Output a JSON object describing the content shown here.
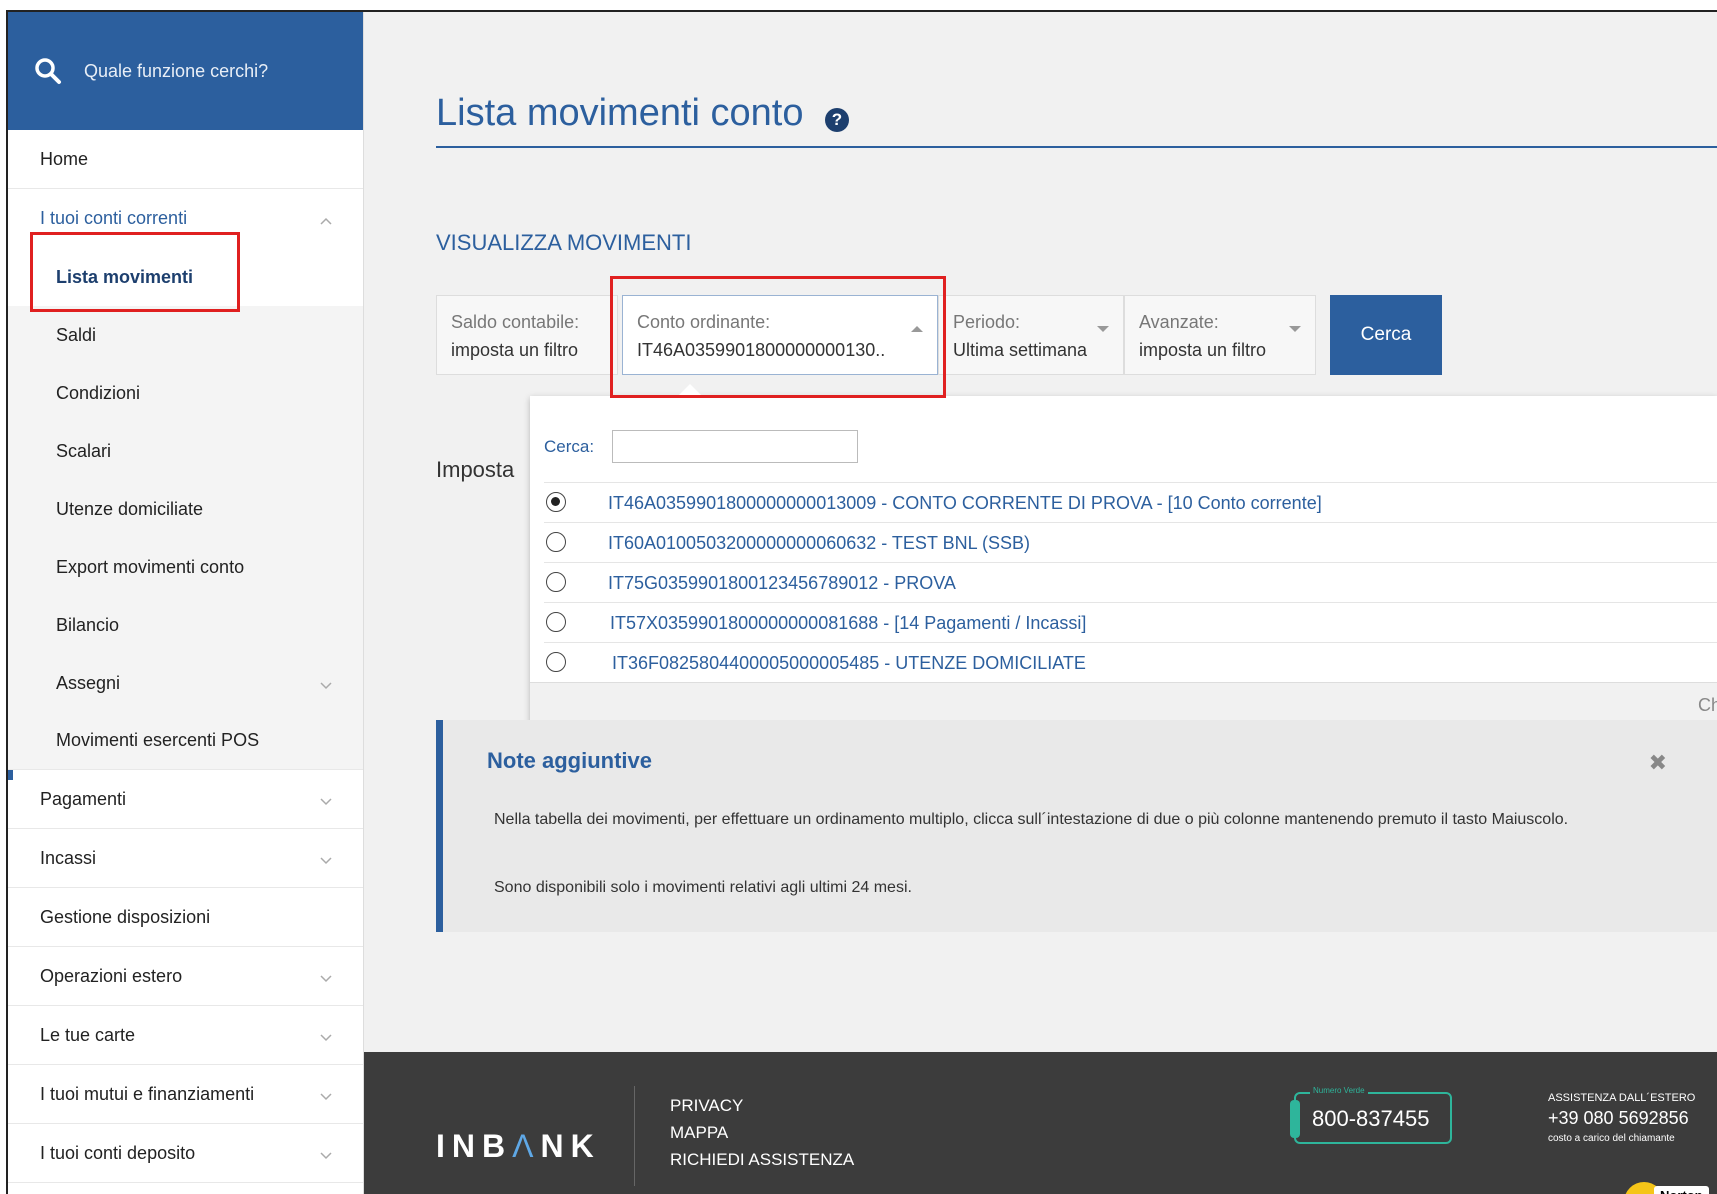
{
  "search": {
    "placeholder": "Quale funzione cerchi?"
  },
  "sidebar": {
    "home": "Home",
    "group": {
      "label": "I tuoi conti correnti"
    },
    "sub_items": [
      {
        "label": "Lista movimenti"
      },
      {
        "label": "Saldi"
      },
      {
        "label": "Condizioni"
      },
      {
        "label": "Scalari"
      },
      {
        "label": "Utenze domiciliate"
      },
      {
        "label": "Export movimenti conto"
      },
      {
        "label": "Bilancio"
      },
      {
        "label": "Assegni"
      },
      {
        "label": "Movimenti esercenti POS"
      }
    ],
    "items": [
      {
        "label": "Pagamenti"
      },
      {
        "label": "Incassi"
      },
      {
        "label": "Gestione disposizioni"
      },
      {
        "label": "Operazioni estero"
      },
      {
        "label": "Le tue carte"
      },
      {
        "label": "I tuoi mutui e finanziamenti"
      },
      {
        "label": "I tuoi conti deposito"
      }
    ]
  },
  "page": {
    "title": "Lista movimenti conto",
    "help_icon": "?",
    "section": "VISUALIZZA MOVIMENTI",
    "imposta": "Imposta"
  },
  "filters": {
    "saldo": {
      "label": "Saldo contabile:",
      "value": "imposta un filtro"
    },
    "conto": {
      "label": "Conto ordinante:",
      "value": "IT46A0359901800000000130.."
    },
    "periodo": {
      "label": "Periodo:",
      "value": "Ultima settimana"
    },
    "avanzate": {
      "label": "Avanzate:",
      "value": "imposta un filtro"
    },
    "search_button": "Cerca"
  },
  "dropdown": {
    "search_label": "Cerca:",
    "search_value": "",
    "options": [
      {
        "text": "IT46A0359901800000000013009 - CONTO CORRENTE DI PROVA - [10 Conto corrente]",
        "selected": true
      },
      {
        "text": "IT60A0100503200000000060632 - TEST BNL (SSB)",
        "selected": false
      },
      {
        "text": "IT75G0359901800123456789012 - PROVA",
        "selected": false
      },
      {
        "text": "IT57X0359901800000000081688 - [14 Pagamenti / Incassi]",
        "selected": false
      },
      {
        "text": "IT36F0825804400005000005485 - UTENZE DOMICILIATE",
        "selected": false
      }
    ],
    "footer_text": "Ch"
  },
  "note": {
    "title": "Note aggiuntive",
    "close": "✖",
    "p1": "Nella tabella dei movimenti, per effettuare un ordinamento multiplo, clicca sull´intestazione di due o più colonne mantenendo premuto il tasto Maiuscolo.",
    "p2": "Sono disponibili solo i movimenti relativi agli ultimi 24 mesi."
  },
  "footer": {
    "logo_a": "INB",
    "logo_b": "Λ",
    "logo_c": "NK",
    "links": [
      "PRIVACY",
      "MAPPA",
      "RICHIEDI ASSISTENZA"
    ],
    "numero_verde_tag": "Numero Verde",
    "numero_verde": "800-837455",
    "estero_title": "ASSISTENZA DALL´ESTERO",
    "estero_number": "+39 080 5692856",
    "estero_note": "costo a carico del chiamante",
    "norton": "Norton"
  },
  "colors": {
    "brand": "#2c5f9e",
    "highlight": "#e02020",
    "footer_bg": "#3c3c3c"
  }
}
